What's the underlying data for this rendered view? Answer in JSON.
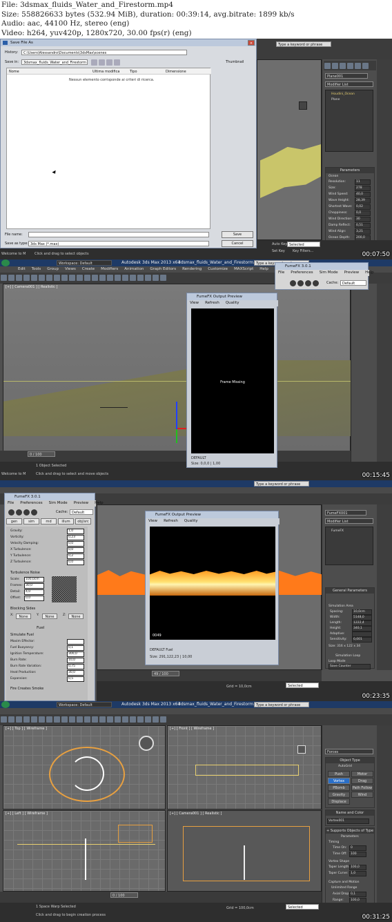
{
  "header": {
    "file": "File: 3dsmax_fluids_Water_and_Firestorm.mp4",
    "size": "Size: 558826633 bytes (532.94 MiB), duration: 00:39:14, avg.bitrate: 1899 kb/s",
    "audio": "Audio: aac, 44100 Hz, stereo (eng)",
    "video": "Video: h264, yuv420p, 1280x720, 30.00 fps(r) (eng)"
  },
  "frames": {
    "f1": {
      "timestamp": "00:07:50",
      "dialog_title": "Save File As",
      "history_label": "History:",
      "history_value": "C:\\Users\\Alessandro\\Documents\\3dsMax\\scenes",
      "savein_label": "Save in:",
      "savein_value": "3dsmax_fluids_Water_and_Firestorm",
      "thumbnail_label": "Thumbnail",
      "columns": [
        "Nome",
        "Ultima modifica",
        "Tipo",
        "Dimensione"
      ],
      "empty_msg": "Nessun elemento corrisponde ai criteri di ricerca.",
      "filename_label": "File name:",
      "savetype_label": "Save as type:",
      "savetype_value": "3ds Max (*.max)",
      "save_btn": "Save",
      "cancel_btn": "Cancel",
      "object_name": "Plane001",
      "modifier_list": "Modifier List",
      "stack": [
        "Houdini_Ocean",
        "Plane"
      ],
      "params_title": "Parameters",
      "params_group": "Ocean",
      "params": [
        {
          "label": "Resolution:",
          "value": "11"
        },
        {
          "label": "Size:",
          "value": "278"
        },
        {
          "label": "Wind Speed:",
          "value": "40,0"
        },
        {
          "label": "Wave Height:",
          "value": "28,39"
        },
        {
          "label": "Shortest Wave:",
          "value": "0,02"
        },
        {
          "label": "Choppiness:",
          "value": "0,0"
        },
        {
          "label": "Wind Direction:",
          "value": "30"
        },
        {
          "label": "Damp Reflect:",
          "value": "0,51"
        },
        {
          "label": "Wind Align:",
          "value": "3,21"
        },
        {
          "label": "Ocean Depth:",
          "value": "200,0"
        },
        {
          "label": "Time:",
          "value": "0,02"
        },
        {
          "label": "Seed:",
          "value": "0,0"
        }
      ],
      "search_placeholder": "Type a keyword or phrase",
      "status_left": "Click and drag to select objects",
      "autokey": "Auto Key",
      "selected": "Selected",
      "setkey": "Set Key",
      "keyfilters": "Key Filters...",
      "welcome": "Welcome to M"
    },
    "f2": {
      "timestamp": "00:15:45",
      "app_title": "Autodesk 3ds Max 2013 x64",
      "scene_file": "3dsmax_fluids_Water_and_Firestorm.max",
      "workspace": "Workspace: Default",
      "menus": [
        "Edit",
        "Tools",
        "Group",
        "Views",
        "Create",
        "Modifiers",
        "Animation",
        "Graph Editors",
        "Rendering",
        "Customize",
        "MAXScript",
        "Help",
        "Krakatoa"
      ],
      "viewport_label": "[+] [ Camera001 ] [ Realistic ]",
      "fumefx_title": "FumeFX 3.0.1",
      "fumefx_menus": [
        "File",
        "Preferences",
        "Sim Mode",
        "Preview",
        "Help"
      ],
      "cache_label": "Cache:",
      "cache_value": "Default",
      "preview_title": "FumeFX Output Preview",
      "preview_menus": [
        "View",
        "Refresh",
        "Quality"
      ],
      "preview_msg": "Frame Missing",
      "preview_footer1": "DEFAULT",
      "preview_footer2": "Size: 0,0,0 | 1,00",
      "frame_counter": "0 / 100",
      "status_selected": "1 Object Selected",
      "status_left": "Click and drag to select and move objects",
      "welcome": "Welcome to M",
      "search_placeholder": "Type a keyword or phrase"
    },
    "f3": {
      "timestamp": "00:23:35",
      "fumefx_title": "FumeFX 3.0.1",
      "fumefx_menus": [
        "File",
        "Preferences",
        "Sim Mode",
        "Preview",
        "Help"
      ],
      "tabs": [
        "gen",
        "sim",
        "rnd",
        "illum",
        "obj/src"
      ],
      "cache_label": "Cache:",
      "cache_value": "Default",
      "sim_params": [
        {
          "label": "Gravity:",
          "value": "1,0"
        },
        {
          "label": "Vorticity:",
          "value": "0,23"
        },
        {
          "label": "Velocity Damping:",
          "value": "0,0"
        },
        {
          "label": "X Turbulence:",
          "value": "0,0"
        },
        {
          "label": "Y Turbulence:",
          "value": "0,2"
        },
        {
          "label": "Z Turbulence:",
          "value": "0,0"
        }
      ],
      "turb_title": "Turbulence Noise",
      "turb_params": [
        {
          "label": "Scale:",
          "value": "100,0cm"
        },
        {
          "label": "Frames:",
          "value": "30,0"
        },
        {
          "label": "Detail:",
          "value": "4,0"
        },
        {
          "label": "Offset:",
          "value": "0,0"
        }
      ],
      "blocking_title": "Blocking Sides",
      "blocking": [
        "X:",
        "None",
        "Y:",
        "None",
        "Z:",
        "None"
      ],
      "fuel_title": "Fuel",
      "simulate_fuel": "Simulate Fuel",
      "fuel_params": [
        {
          "label": "Maxim Effector:",
          "value": ""
        },
        {
          "label": "Fuel Buoyancy:",
          "value": "0,1"
        },
        {
          "label": "Ignition Temperature:",
          "value": "300,0"
        },
        {
          "label": "Burn Rate:",
          "value": "10,0"
        },
        {
          "label": "Burn Rate Variation:",
          "value": "0,75"
        },
        {
          "label": "Heat Production:",
          "value": "30,0"
        },
        {
          "label": "Expansion:",
          "value": "0,5"
        }
      ],
      "fire_creates_smoke": "Fire Creates Smoke",
      "preview_title": "FumeFX Output Preview",
      "preview_menus": [
        "View",
        "Refresh",
        "Quality"
      ],
      "preview_frame": "0049",
      "preview_footer1": "DEFAULT Fuel",
      "preview_footer2": "Size: 291,122,23 | 10,00",
      "object_name": "FumeFX001",
      "modifier_list": "Modifier List",
      "stack": [
        "FumeFX"
      ],
      "gp_title": "General Parameters",
      "sim_area": "Simulation Area",
      "gp_params": [
        {
          "label": "Spacing:",
          "value": "10,0cm"
        },
        {
          "label": "Width:",
          "value": "5148,0"
        },
        {
          "label": "Length:",
          "value": "1222,4"
        },
        {
          "label": "Height:",
          "value": "340,1"
        },
        {
          "label": "Adaptive:",
          "value": ""
        },
        {
          "label": "Sensitivity:",
          "value": "0,001"
        }
      ],
      "gp_size": "Size: 316 x 122 x 34",
      "sim_loop": "Simulation Loop",
      "loop_mode": "Loop Mode",
      "loop_value": "Save Counter",
      "frame_counter": "49 / 100",
      "grid": "Grid = 10,0cm",
      "selected": "Selected",
      "search_placeholder": "Type a keyword or phrase"
    },
    "f4": {
      "timestamp": "00:31:25",
      "app_title": "Autodesk 3ds Max 2013 x64",
      "scene_file": "3dsmax_fluids_Water_and_Firestorm.max",
      "workspace": "Workspace: Default",
      "vp_top": "[+] [ Top ] [ Wireframe ]",
      "vp_front": "[+] [ Front ] [ Wireframe ]",
      "vp_left": "[+] [ Left ] [ Wireframe ]",
      "vp_camera": "[+] [ Camera001 ] [ Realistic ]",
      "forces": "Forces",
      "object_type": "Object Type",
      "autogrid": "AutoGrid",
      "obj_buttons": [
        "Push",
        "Motor",
        "Vortex",
        "Drag",
        "PBomb",
        "Path Follow",
        "Gravity",
        "Wind",
        "Displace"
      ],
      "name_color": "Name and Color",
      "name_value": "Vortex001",
      "supports": "+ Supports Objects of Type",
      "parameters": "Parameters",
      "timing": "Timing",
      "time_on": "Time On:",
      "time_on_val": "0",
      "time_off": "Time Off:",
      "time_off_val": "100",
      "vortex_shape": "Vortex Shape",
      "taper_length": "Taper Length:",
      "taper_length_val": "100,0",
      "taper_curve": "Taper Curve:",
      "taper_curve_val": "1,0",
      "capture": "Capture and Motion",
      "unlimited": "Unlimited Range",
      "axial_drop": "Axial Drop:",
      "axial_drop_val": "0,1",
      "range": "Range:",
      "range_val": "100,0",
      "frame_counter": "0 / 100",
      "status_selected": "1 Space Warp Selected",
      "status_left": "Click and drag to begin creation process",
      "grid": "Grid = 100,0cm",
      "selected": "Selected",
      "search_placeholder": "Type a keyword or phrase"
    }
  },
  "colors": {
    "max_bg": "#505050",
    "titlebar": "#1e3a66",
    "fire": "#ff7a1a",
    "ocean": "#c8c870",
    "preview_bg": "#000000"
  }
}
